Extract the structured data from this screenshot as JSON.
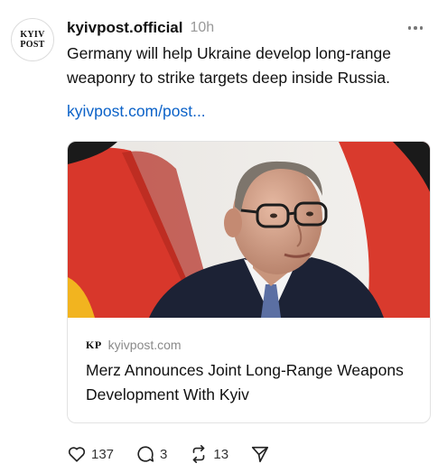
{
  "avatar": {
    "line1": "KYIV",
    "line2": "POST"
  },
  "post": {
    "username": "kyivpost.official",
    "time": "10h",
    "text": "Germany will help Ukraine develop long-range weaponry to strike targets deep inside Russia.",
    "link": "kyivpost.com/post..."
  },
  "card": {
    "logo": "KP",
    "domain": "kyivpost.com",
    "title": "Merz Announces Joint Long-Range Weapons Development With Kyiv"
  },
  "actions": {
    "likes": "137",
    "replies": "3",
    "reposts": "13"
  },
  "colors": {
    "link": "#0b62c8",
    "flag_red": "#d8372b",
    "flag_gold": "#f2b41f",
    "suit": "#1c2235"
  },
  "icons": [
    "heart-icon",
    "comment-icon",
    "repost-icon",
    "share-icon",
    "more-icon"
  ]
}
